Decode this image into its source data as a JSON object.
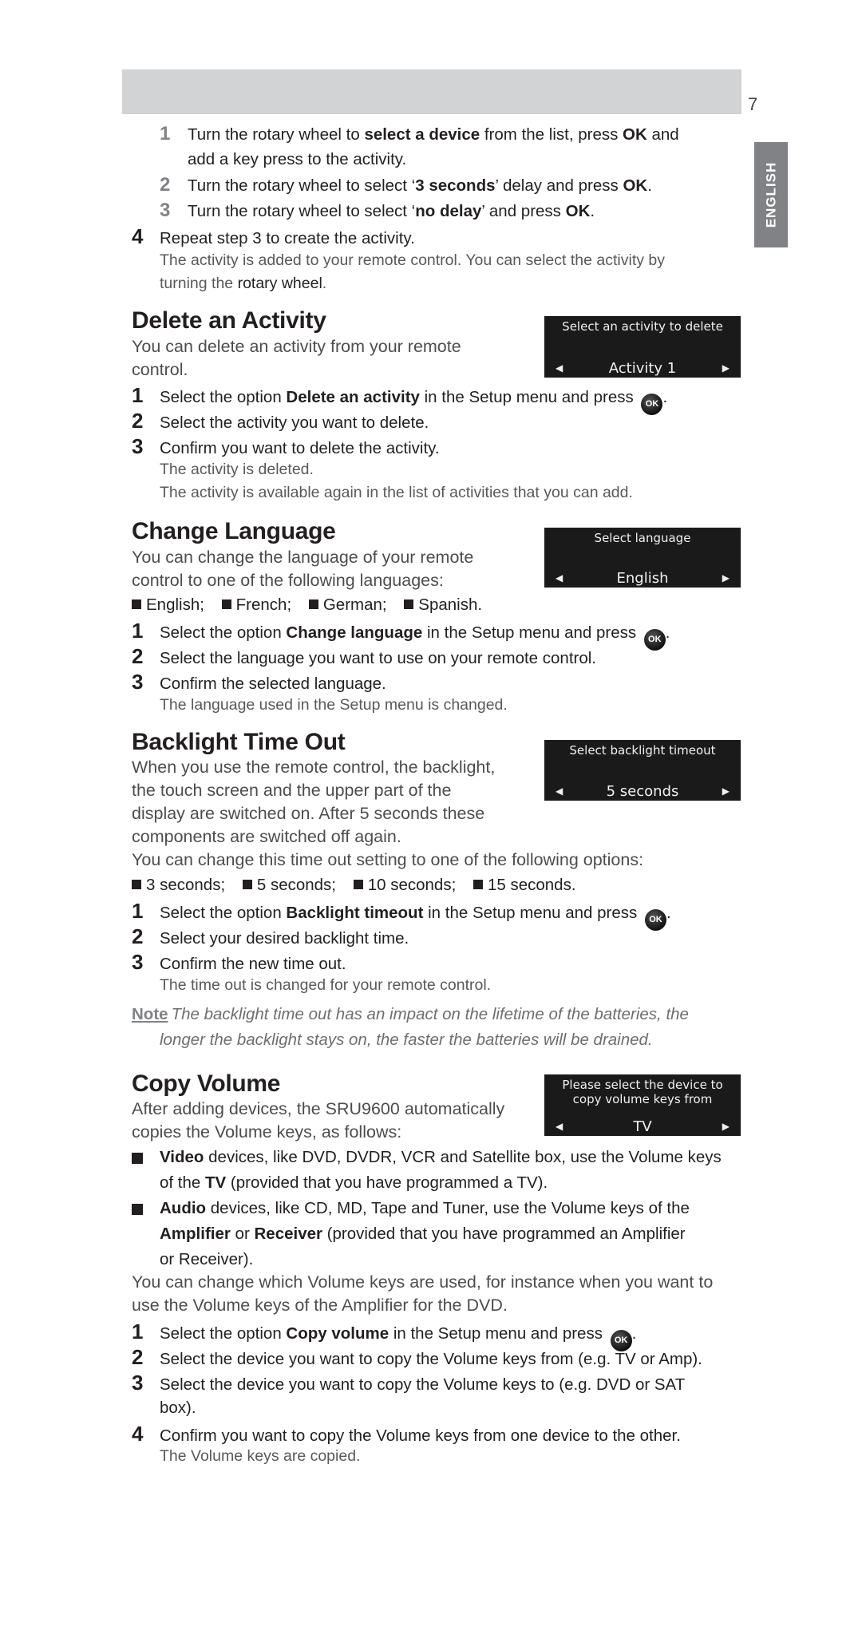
{
  "page": {
    "number": "7",
    "language_tab": "ENGLISH"
  },
  "intro": {
    "substeps": [
      {
        "num": "1",
        "parts": [
          [
            "Turn the rotary wheel to ",
            false
          ],
          [
            "select a device",
            true
          ],
          [
            " from the list, press ",
            false
          ],
          [
            "OK",
            true
          ],
          [
            " and",
            false
          ]
        ],
        "cont": "add a key press to the activity."
      },
      {
        "num": "2",
        "parts": [
          [
            "Turn the rotary wheel to select ‘",
            false
          ],
          [
            "3 seconds",
            true
          ],
          [
            "’ delay and press ",
            false
          ],
          [
            "OK",
            true
          ],
          [
            ".",
            false
          ]
        ]
      },
      {
        "num": "3",
        "parts": [
          [
            "Turn the rotary wheel to select ‘",
            false
          ],
          [
            "no delay",
            true
          ],
          [
            "’ and press ",
            false
          ],
          [
            "OK",
            true
          ],
          [
            ".",
            false
          ]
        ]
      }
    ],
    "step4": {
      "num": "4",
      "text": "Repeat step 3 to create the activity."
    },
    "result_line1": "The activity is added to your remote control. You can select the activity by",
    "result_line2_prefix": "turning the ",
    "result_line2_bold": "rotary wheel",
    "result_line2_suffix": "."
  },
  "sections": {
    "delete": {
      "title": "Delete an Activity",
      "desc_line1": "You can delete an activity from your remote",
      "desc_line2": "control.",
      "lcd": {
        "title": "Select an activity to delete",
        "value": "Activity 1"
      },
      "steps": [
        {
          "num": "1",
          "pre": "Select the option ",
          "bold": "Delete an activity",
          "post": " in the Setup menu and press ",
          "ok": true
        },
        {
          "num": "2",
          "text": "Select the activity you want to delete."
        },
        {
          "num": "3",
          "text": "Confirm you want to delete the activity."
        }
      ],
      "results": [
        "The activity is deleted.",
        "The activity is available again in the list of activities that you can add."
      ]
    },
    "language": {
      "title": "Change Language",
      "desc_line1": "You can change the language of your remote",
      "desc_line2": "control to one of the following languages:",
      "lcd": {
        "title": "Select language",
        "value": "English"
      },
      "options": [
        "English;",
        "French;",
        "German;",
        "Spanish."
      ],
      "steps": [
        {
          "num": "1",
          "pre": "Select the option ",
          "bold": "Change language",
          "post": " in the Setup menu and press ",
          "ok": true
        },
        {
          "num": "2",
          "text": "Select the language you want to use on your remote control."
        },
        {
          "num": "3",
          "text": "Confirm the selected language."
        }
      ],
      "results": [
        "The language used in the Setup menu is changed."
      ]
    },
    "backlight": {
      "title": "Backlight Time Out",
      "desc_lines": [
        "When you use the remote control, the backlight,",
        "the touch screen and the upper part of the",
        "display are switched on. After 5 seconds these",
        "components are switched off again."
      ],
      "desc_full": "You can change this time out setting to one of the following options:",
      "lcd": {
        "title": "Select backlight timeout",
        "value": "5 seconds"
      },
      "options": [
        "3 seconds;",
        "5 seconds;",
        "10 seconds;",
        "15 seconds."
      ],
      "steps": [
        {
          "num": "1",
          "pre": "Select the option ",
          "bold": "Backlight timeout",
          "post": " in the Setup menu and press ",
          "ok": true
        },
        {
          "num": "2",
          "text": "Select your desired backlight time."
        },
        {
          "num": "3",
          "text": "Confirm the new time out."
        }
      ],
      "results": [
        "The time out is changed for your remote control."
      ],
      "note": {
        "label": "Note",
        "line1": "The backlight time out has an impact on the lifetime of the batteries, the",
        "line2": "longer the backlight stays on, the faster the batteries will be drained."
      }
    },
    "copy_volume": {
      "title": "Copy Volume",
      "desc_line1": "After adding devices, the SRU9600 automatically",
      "desc_line2": "copies the Volume keys, as follows:",
      "lcd": {
        "title_line1": "Please select the device to",
        "title_line2": "copy volume keys from",
        "value": "TV"
      },
      "bullets": [
        {
          "l1": [
            [
              "Video",
              true
            ],
            [
              " devices, like DVD, DVDR, VCR and Satellite box, use the Volume keys",
              false
            ]
          ],
          "l2": [
            [
              "of the ",
              false
            ],
            [
              "TV",
              true
            ],
            [
              " (provided that you have programmed a TV).",
              false
            ]
          ]
        },
        {
          "l1": [
            [
              "Audio",
              true
            ],
            [
              " devices, like CD, MD, Tape and Tuner, use the Volume keys of the",
              false
            ]
          ],
          "l2": [
            [
              "Amplifier",
              true
            ],
            [
              " or ",
              false
            ],
            [
              "Receiver",
              true
            ],
            [
              " (provided that you have programmed an Amplifier",
              false
            ]
          ],
          "l3": [
            [
              "or Receiver).",
              false
            ]
          ]
        }
      ],
      "change_line1": "You can change which Volume keys are used, for instance when you want to",
      "change_line2": "use the Volume keys of the Amplifier for the DVD.",
      "steps": [
        {
          "num": "1",
          "pre": "Select the option ",
          "bold": "Copy volume",
          "post": " in the Setup menu and press ",
          "ok": true
        },
        {
          "num": "2",
          "text": "Select the device you want to copy the Volume keys from (e.g. TV or Amp)."
        },
        {
          "num": "3",
          "text": "Select the device you want to copy the Volume keys to (e.g. DVD or SAT",
          "cont": "box)."
        },
        {
          "num": "4",
          "text": "Confirm you want to copy the Volume keys from one device to the other."
        }
      ],
      "results": [
        "The Volume keys are copied."
      ]
    }
  },
  "icons": {
    "ok_button_label": "OK",
    "arrow_left": "◀",
    "arrow_right": "▶"
  }
}
